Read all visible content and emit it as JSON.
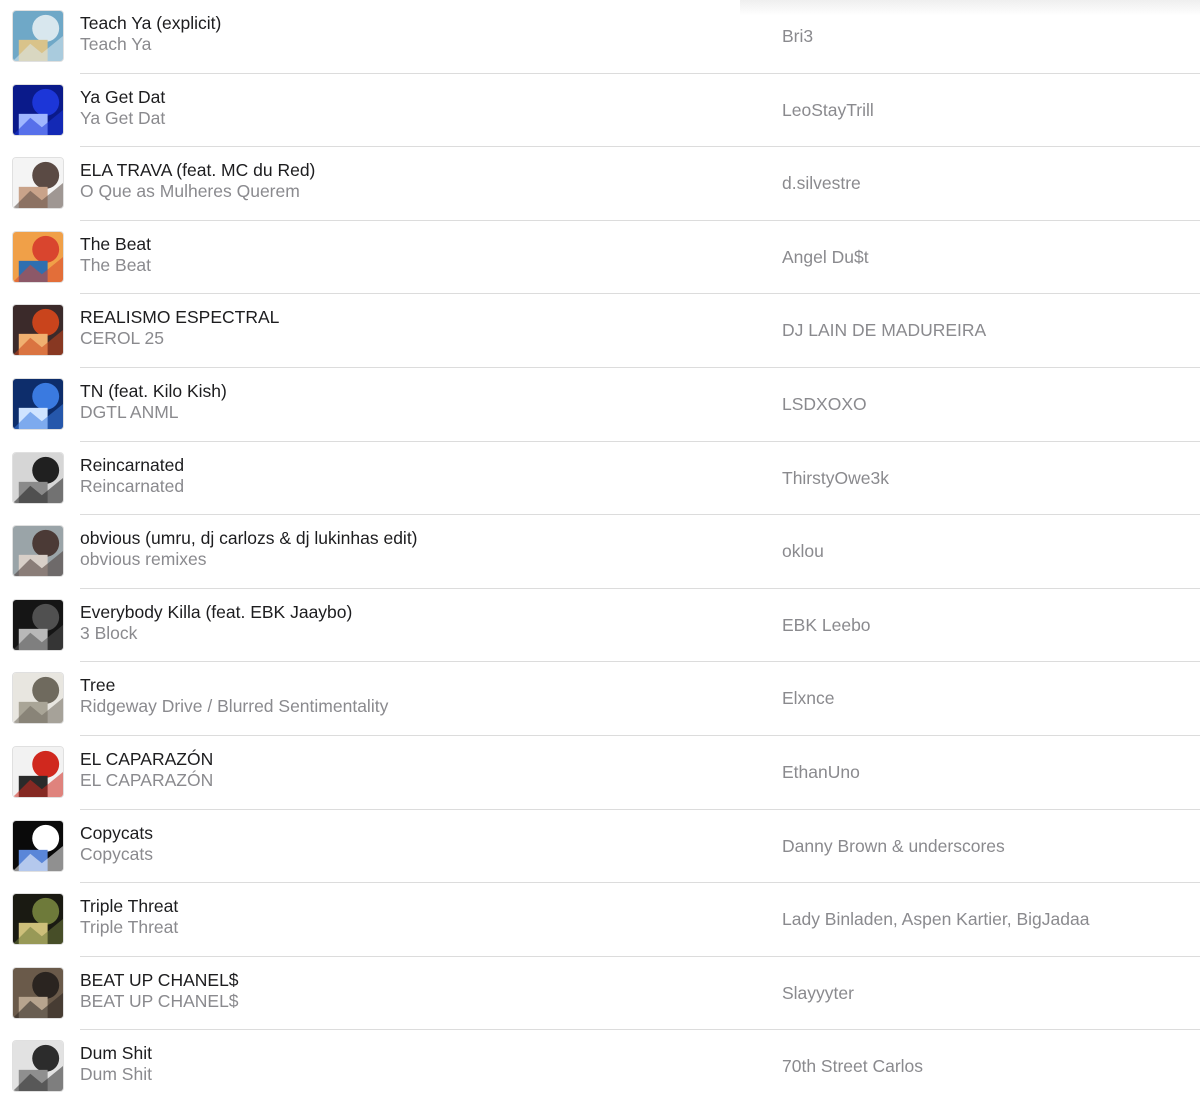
{
  "tracks": [
    {
      "title": "Teach Ya (explicit)",
      "album": "Teach Ya",
      "artist": "Bri3",
      "art_colors": [
        "#6fa8c7",
        "#d8e7ee",
        "#d9c38a"
      ],
      "art_icon": "tennis-player-artwork"
    },
    {
      "title": "Ya Get Dat",
      "album": "Ya Get Dat",
      "artist": "LeoStayTrill",
      "art_colors": [
        "#0a1a8a",
        "#1c36d8",
        "#9fb6ff"
      ],
      "art_icon": "script-text-artwork"
    },
    {
      "title": "ELA TRAVA (feat. MC du Red)",
      "album": "O Que as Mulheres Querem",
      "artist": "d.silvestre",
      "art_colors": [
        "#f4f4f4",
        "#5a4a44",
        "#c9a38a"
      ],
      "art_icon": "portrait-artwork"
    },
    {
      "title": "The Beat",
      "album": "The Beat",
      "artist": "Angel Du$t",
      "art_colors": [
        "#f0a048",
        "#d9452e",
        "#2f6fb0"
      ],
      "art_icon": "can-artwork"
    },
    {
      "title": "REALISMO ESPECTRAL",
      "album": "CEROL 25",
      "artist": "DJ LAIN DE MADUREIRA",
      "art_colors": [
        "#3b2a2a",
        "#c9441c",
        "#f0b070"
      ],
      "art_icon": "fire-artwork"
    },
    {
      "title": "TN (feat. Kilo Kish)",
      "album": "DGTL ANML",
      "artist": "LSDXOXO",
      "art_colors": [
        "#0d2d6b",
        "#3a7ae0",
        "#cfe4ff"
      ],
      "art_icon": "burst-artwork"
    },
    {
      "title": "Reincarnated",
      "album": "Reincarnated",
      "artist": "ThirstyOwe3k",
      "art_colors": [
        "#d6d6d6",
        "#202020",
        "#8a8a8a"
      ],
      "art_icon": "hooded-figure-artwork"
    },
    {
      "title": "obvious (umru, dj carlozs & dj lukinhas edit)",
      "album": "obvious remixes",
      "artist": "oklou",
      "art_colors": [
        "#9aa4a8",
        "#4b3a36",
        "#d8cfc8"
      ],
      "art_icon": "photo-artwork"
    },
    {
      "title": "Everybody Killa (feat. EBK Jaaybo)",
      "album": "3 Block",
      "artist": "EBK Leebo",
      "art_colors": [
        "#151515",
        "#505050",
        "#b8b8b8"
      ],
      "art_icon": "group-photo-artwork"
    },
    {
      "title": "Tree",
      "album": "Ridgeway Drive / Blurred Sentimentality",
      "artist": "Elxnce",
      "art_colors": [
        "#e8e6e0",
        "#6f6a5e",
        "#a9a597"
      ],
      "art_icon": "room-artwork"
    },
    {
      "title": "EL CAPARAZÓN",
      "album": "EL CAPARAZÓN",
      "artist": "EthanUno",
      "art_colors": [
        "#f2f2f2",
        "#d0281e",
        "#2a2a2a"
      ],
      "art_icon": "collage-artwork"
    },
    {
      "title": "Copycats",
      "album": "Copycats",
      "artist": "Danny Brown & underscores",
      "art_colors": [
        "#0a0a0a",
        "#ffffff",
        "#5a86d8"
      ],
      "art_icon": "star-artwork"
    },
    {
      "title": "Triple Threat",
      "album": "Triple Threat",
      "artist": "Lady Binladen, Aspen Kartier, BigJadaa",
      "art_colors": [
        "#1a1a12",
        "#6e7a3a",
        "#cdbf7a"
      ],
      "art_icon": "trio-photo-artwork"
    },
    {
      "title": "BEAT UP CHANEL$",
      "album": "BEAT UP CHANEL$",
      "artist": "Slayyyter",
      "art_colors": [
        "#6a5a4a",
        "#2a2420",
        "#b7a48e"
      ],
      "art_icon": "street-photo-artwork"
    },
    {
      "title": "Dum Shit",
      "album": "Dum Shit",
      "artist": "70th Street Carlos",
      "art_colors": [
        "#e2e2e2",
        "#2c2c2c",
        "#8f8f8f"
      ],
      "art_icon": "doorway-photo-artwork"
    }
  ]
}
